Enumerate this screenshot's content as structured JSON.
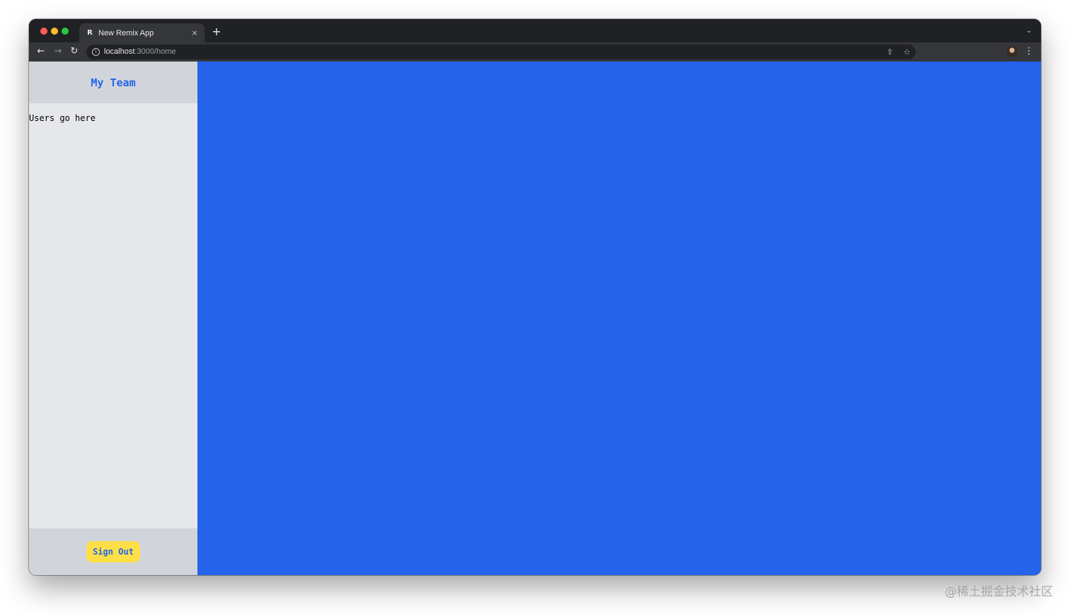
{
  "browser": {
    "tab_title": "New Remix App",
    "tab_favicon": "remix-logo-icon",
    "tab_close": "×",
    "new_tab": "+",
    "tab_search": "⌄",
    "url_host": "localhost",
    "url_path": ":3000/home",
    "nav": {
      "back": "←",
      "forward": "→",
      "reload": "↻"
    },
    "icons": {
      "info": "i",
      "share": "⇧",
      "star": "☆",
      "menu": "⋮"
    }
  },
  "sidebar": {
    "title": "My Team",
    "users_placeholder": "Users go here",
    "sign_out_label": "Sign Out"
  },
  "colors": {
    "sidebar_bg": "#e5e7eb",
    "sidebar_header_bg": "#d1d5db",
    "accent_blue": "#2563eb",
    "button_yellow": "#fde047"
  },
  "watermark": "@稀土掘金技术社区"
}
